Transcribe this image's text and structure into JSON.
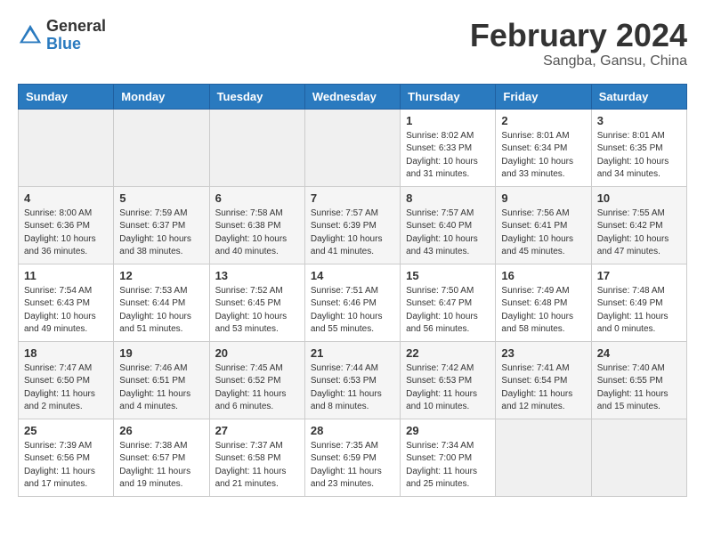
{
  "header": {
    "logo_general": "General",
    "logo_blue": "Blue",
    "month_year": "February 2024",
    "location": "Sangba, Gansu, China"
  },
  "days_of_week": [
    "Sunday",
    "Monday",
    "Tuesday",
    "Wednesday",
    "Thursday",
    "Friday",
    "Saturday"
  ],
  "weeks": [
    [
      {
        "day": "",
        "info": ""
      },
      {
        "day": "",
        "info": ""
      },
      {
        "day": "",
        "info": ""
      },
      {
        "day": "",
        "info": ""
      },
      {
        "day": "1",
        "info": "Sunrise: 8:02 AM\nSunset: 6:33 PM\nDaylight: 10 hours\nand 31 minutes."
      },
      {
        "day": "2",
        "info": "Sunrise: 8:01 AM\nSunset: 6:34 PM\nDaylight: 10 hours\nand 33 minutes."
      },
      {
        "day": "3",
        "info": "Sunrise: 8:01 AM\nSunset: 6:35 PM\nDaylight: 10 hours\nand 34 minutes."
      }
    ],
    [
      {
        "day": "4",
        "info": "Sunrise: 8:00 AM\nSunset: 6:36 PM\nDaylight: 10 hours\nand 36 minutes."
      },
      {
        "day": "5",
        "info": "Sunrise: 7:59 AM\nSunset: 6:37 PM\nDaylight: 10 hours\nand 38 minutes."
      },
      {
        "day": "6",
        "info": "Sunrise: 7:58 AM\nSunset: 6:38 PM\nDaylight: 10 hours\nand 40 minutes."
      },
      {
        "day": "7",
        "info": "Sunrise: 7:57 AM\nSunset: 6:39 PM\nDaylight: 10 hours\nand 41 minutes."
      },
      {
        "day": "8",
        "info": "Sunrise: 7:57 AM\nSunset: 6:40 PM\nDaylight: 10 hours\nand 43 minutes."
      },
      {
        "day": "9",
        "info": "Sunrise: 7:56 AM\nSunset: 6:41 PM\nDaylight: 10 hours\nand 45 minutes."
      },
      {
        "day": "10",
        "info": "Sunrise: 7:55 AM\nSunset: 6:42 PM\nDaylight: 10 hours\nand 47 minutes."
      }
    ],
    [
      {
        "day": "11",
        "info": "Sunrise: 7:54 AM\nSunset: 6:43 PM\nDaylight: 10 hours\nand 49 minutes."
      },
      {
        "day": "12",
        "info": "Sunrise: 7:53 AM\nSunset: 6:44 PM\nDaylight: 10 hours\nand 51 minutes."
      },
      {
        "day": "13",
        "info": "Sunrise: 7:52 AM\nSunset: 6:45 PM\nDaylight: 10 hours\nand 53 minutes."
      },
      {
        "day": "14",
        "info": "Sunrise: 7:51 AM\nSunset: 6:46 PM\nDaylight: 10 hours\nand 55 minutes."
      },
      {
        "day": "15",
        "info": "Sunrise: 7:50 AM\nSunset: 6:47 PM\nDaylight: 10 hours\nand 56 minutes."
      },
      {
        "day": "16",
        "info": "Sunrise: 7:49 AM\nSunset: 6:48 PM\nDaylight: 10 hours\nand 58 minutes."
      },
      {
        "day": "17",
        "info": "Sunrise: 7:48 AM\nSunset: 6:49 PM\nDaylight: 11 hours\nand 0 minutes."
      }
    ],
    [
      {
        "day": "18",
        "info": "Sunrise: 7:47 AM\nSunset: 6:50 PM\nDaylight: 11 hours\nand 2 minutes."
      },
      {
        "day": "19",
        "info": "Sunrise: 7:46 AM\nSunset: 6:51 PM\nDaylight: 11 hours\nand 4 minutes."
      },
      {
        "day": "20",
        "info": "Sunrise: 7:45 AM\nSunset: 6:52 PM\nDaylight: 11 hours\nand 6 minutes."
      },
      {
        "day": "21",
        "info": "Sunrise: 7:44 AM\nSunset: 6:53 PM\nDaylight: 11 hours\nand 8 minutes."
      },
      {
        "day": "22",
        "info": "Sunrise: 7:42 AM\nSunset: 6:53 PM\nDaylight: 11 hours\nand 10 minutes."
      },
      {
        "day": "23",
        "info": "Sunrise: 7:41 AM\nSunset: 6:54 PM\nDaylight: 11 hours\nand 12 minutes."
      },
      {
        "day": "24",
        "info": "Sunrise: 7:40 AM\nSunset: 6:55 PM\nDaylight: 11 hours\nand 15 minutes."
      }
    ],
    [
      {
        "day": "25",
        "info": "Sunrise: 7:39 AM\nSunset: 6:56 PM\nDaylight: 11 hours\nand 17 minutes."
      },
      {
        "day": "26",
        "info": "Sunrise: 7:38 AM\nSunset: 6:57 PM\nDaylight: 11 hours\nand 19 minutes."
      },
      {
        "day": "27",
        "info": "Sunrise: 7:37 AM\nSunset: 6:58 PM\nDaylight: 11 hours\nand 21 minutes."
      },
      {
        "day": "28",
        "info": "Sunrise: 7:35 AM\nSunset: 6:59 PM\nDaylight: 11 hours\nand 23 minutes."
      },
      {
        "day": "29",
        "info": "Sunrise: 7:34 AM\nSunset: 7:00 PM\nDaylight: 11 hours\nand 25 minutes."
      },
      {
        "day": "",
        "info": ""
      },
      {
        "day": "",
        "info": ""
      }
    ]
  ]
}
